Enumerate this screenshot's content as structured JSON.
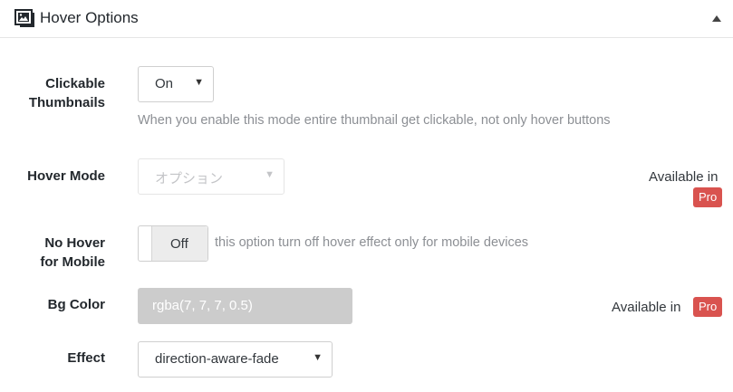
{
  "header": {
    "title": "Hover Options",
    "icon": "image-gallery-icon",
    "collapse_icon": "triangle-up-icon"
  },
  "rows": {
    "clickable": {
      "label_line1": "Clickable",
      "label_line2": "Thumbnails",
      "value": "On",
      "description": "When you enable this mode entire thumbnail get clickable, not only hover buttons"
    },
    "hover_mode": {
      "label": "Hover Mode",
      "value": "オプション",
      "available_text": "Available in",
      "pro_badge": "Pro"
    },
    "no_hover_mobile": {
      "label_line1": "No Hover",
      "label_line2": "for Mobile",
      "toggle_value": "Off",
      "description": "this option turn off hover effect only for mobile devices"
    },
    "bg_color": {
      "label": "Bg Color",
      "value": "rgba(7, 7, 7, 0.5)",
      "available_text": "Available in",
      "pro_badge": "Pro"
    },
    "effect": {
      "label": "Effect",
      "value": "direction-aware-fade"
    }
  },
  "colors": {
    "pro_badge_bg": "#d9534f",
    "color_field_bg": "#cccccc"
  }
}
